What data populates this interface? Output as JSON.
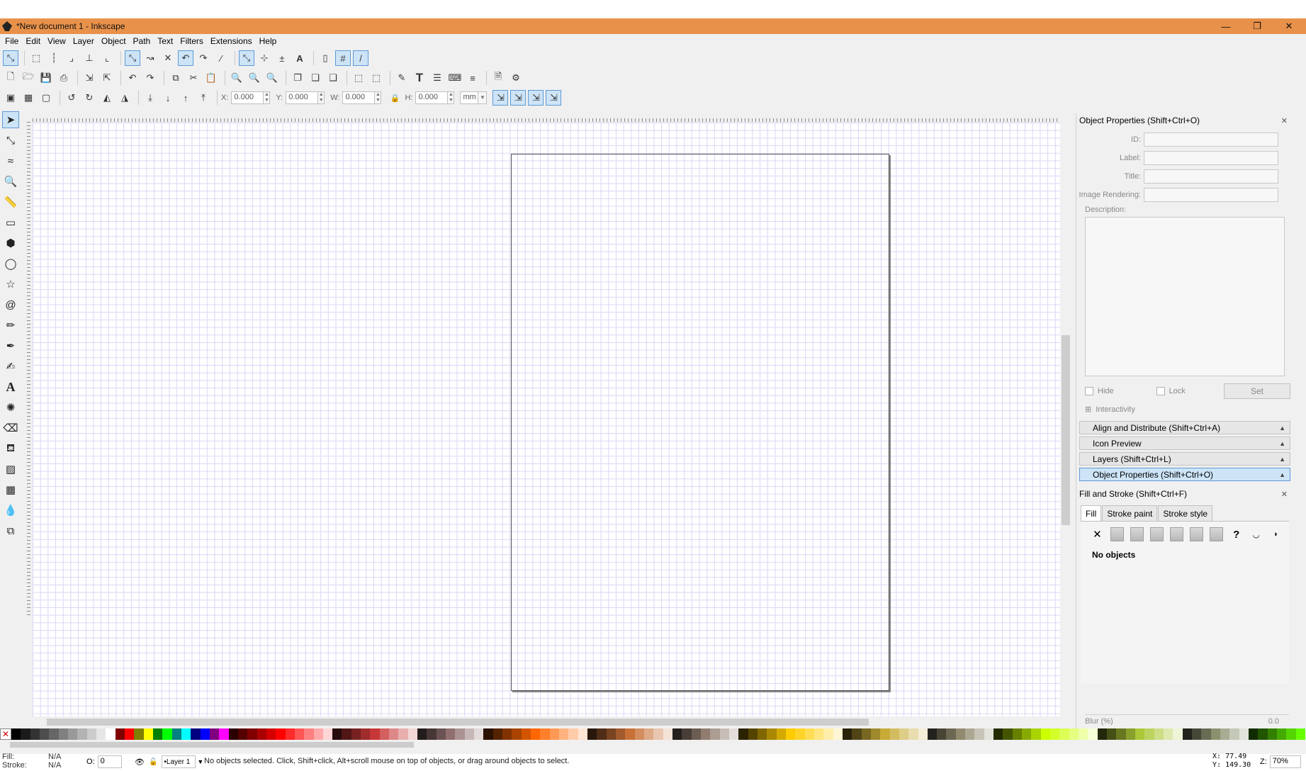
{
  "window": {
    "title": "*New document 1 - Inkscape",
    "minimize": "—",
    "restore": "❐",
    "close": "✕"
  },
  "menu": [
    "File",
    "Edit",
    "View",
    "Layer",
    "Object",
    "Path",
    "Text",
    "Filters",
    "Extensions",
    "Help"
  ],
  "toolbar_select": {
    "x_label": "X:",
    "x_value": "0.000",
    "y_label": "Y:",
    "y_value": "0.000",
    "w_label": "W:",
    "w_value": "0.000",
    "h_label": "H:",
    "h_value": "0.000",
    "unit": "mm"
  },
  "object_properties": {
    "title": "Object Properties (Shift+Ctrl+O)",
    "id_label": "ID:",
    "label_label": "Label:",
    "title_label": "Title:",
    "image_rendering_label": "Image Rendering:",
    "description_label": "Description:",
    "hide_label": "Hide",
    "lock_label": "Lock",
    "set_label": "Set",
    "interactivity_label": "Interactivity"
  },
  "dock_bars": [
    {
      "label": "Align and Distribute (Shift+Ctrl+A)",
      "active": false
    },
    {
      "label": "Icon Preview",
      "active": false
    },
    {
      "label": "Layers (Shift+Ctrl+L)",
      "active": false
    },
    {
      "label": "Object Properties (Shift+Ctrl+O)",
      "active": true
    }
  ],
  "fill_stroke": {
    "title": "Fill and Stroke (Shift+Ctrl+F)",
    "tabs": [
      "Fill",
      "Stroke paint",
      "Stroke style"
    ],
    "selected_tab": "Fill",
    "message": "No objects",
    "blur_label": "Blur (%)",
    "blur_value": "0.0"
  },
  "status": {
    "fill_label": "Fill:",
    "fill_value": "N/A",
    "stroke_label": "Stroke:",
    "stroke_value": "N/A",
    "opacity_label": "O:",
    "opacity_value": "0",
    "layer": "•Layer 1",
    "message": "No objects selected. Click, Shift+click, Alt+scroll mouse on top of objects, or drag around objects to select.",
    "x_label": "X:",
    "x_value": "77.49",
    "y_label": "Y:",
    "y_value": "149.30",
    "zoom_label": "Z:",
    "zoom_value": "70%"
  },
  "palette_colors": [
    "#000000",
    "#1a1a1a",
    "#333333",
    "#4d4d4d",
    "#666666",
    "#808080",
    "#999999",
    "#b3b3b3",
    "#cccccc",
    "#e6e6e6",
    "#ffffff",
    "#800000",
    "#ff0000",
    "#808000",
    "#ffff00",
    "#008000",
    "#00ff00",
    "#008080",
    "#00ffff",
    "#000080",
    "#0000ff",
    "#800080",
    "#ff00ff",
    "#2b0000",
    "#550000",
    "#800000",
    "#aa0000",
    "#d40000",
    "#ff0000",
    "#ff2a2a",
    "#ff5555",
    "#ff8080",
    "#ffaaaa",
    "#ffd5d5",
    "#280b0b",
    "#501616",
    "#782121",
    "#a02c2c",
    "#c83737",
    "#d35f5f",
    "#de8787",
    "#e9afaf",
    "#f4d7d7",
    "#241c1c",
    "#483737",
    "#6c5353",
    "#916f6f",
    "#ac9393",
    "#c8b7b7",
    "#e3dbdb",
    "#2b1100",
    "#552200",
    "#803300",
    "#aa4400",
    "#d45500",
    "#ff6600",
    "#ff7f2a",
    "#ff9955",
    "#ffb380",
    "#ffccaa",
    "#ffe6d5",
    "#28170b",
    "#502d16",
    "#784421",
    "#a05a2c",
    "#c87137",
    "#d38d5f",
    "#deaa87",
    "#e9c6af",
    "#f4e3d7",
    "#241f1c",
    "#483e37",
    "#6c5d53",
    "#917c6f",
    "#ac9d93",
    "#c8beb7",
    "#e3dedb",
    "#2b2200",
    "#554400",
    "#806600",
    "#aa8800",
    "#d4aa00",
    "#ffcc00",
    "#ffd42a",
    "#ffdd55",
    "#ffe680",
    "#ffeeaa",
    "#fff6d5",
    "#28220b",
    "#504416",
    "#786721",
    "#a0892c",
    "#c8ab37",
    "#d3bc5f",
    "#decd87",
    "#e9ddaf",
    "#f4eed7",
    "#24221c",
    "#484537",
    "#6c6753",
    "#918a6f",
    "#aca793",
    "#c8c4b7",
    "#e3e2db",
    "#222b00",
    "#445500",
    "#668000",
    "#88aa00",
    "#aad400",
    "#ccff00",
    "#d4ff2a",
    "#ddff55",
    "#e5ff80",
    "#eeffaa",
    "#f6ffd5",
    "#22280b",
    "#445016",
    "#677821",
    "#89a02c",
    "#abc837",
    "#bcd35f",
    "#cdde87",
    "#dde9af",
    "#eef4d7",
    "#22241c",
    "#454837",
    "#676c53",
    "#8a916f",
    "#a7ac93",
    "#c4c8b7",
    "#e2e3db",
    "#112b00",
    "#225500",
    "#338000",
    "#44aa00",
    "#55d400",
    "#66ff00"
  ]
}
